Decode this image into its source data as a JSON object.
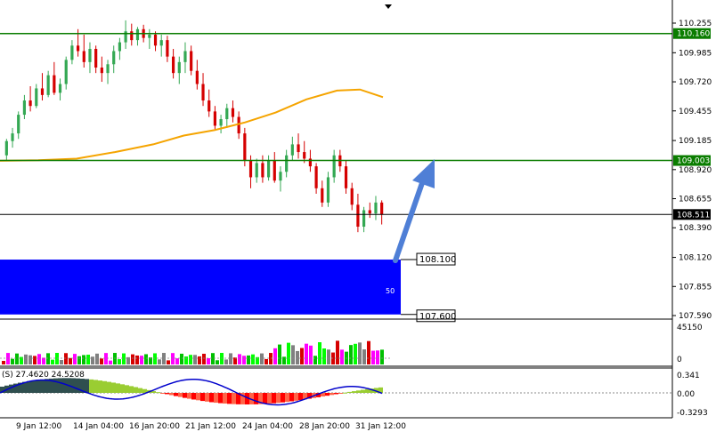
{
  "price_axis": {
    "ticks": [
      "110.255",
      "109.985",
      "109.720",
      "109.455",
      "109.185",
      "108.920",
      "108.655",
      "108.390",
      "108.120",
      "107.855",
      "107.590"
    ],
    "tick_values": [
      110.255,
      109.985,
      109.72,
      109.455,
      109.185,
      108.92,
      108.655,
      108.39,
      108.12,
      107.855,
      107.59
    ]
  },
  "levels": {
    "resistance_upper": {
      "value": 110.16,
      "label": "110.160"
    },
    "resistance_lower": {
      "value": 109.003,
      "label": "109.003"
    },
    "current_price": {
      "value": 108.511,
      "label": "108.511"
    }
  },
  "zone": {
    "top_label": "108.100",
    "top_value": 108.1,
    "bottom_label": "107.600",
    "bottom_value": 107.6,
    "inner_text": "50"
  },
  "volume_panel": {
    "max_label": "45150",
    "min_label": "0"
  },
  "oscillator_panel": {
    "title": "(S) 27.4620 24.5208",
    "tick_labels": [
      "0.341",
      "0.00",
      "-0.3293"
    ]
  },
  "time_axis": {
    "labels": [
      "9 Jan 12:00",
      "14 Jan 04:00",
      "16 Jan 20:00",
      "21 Jan 12:00",
      "24 Jan 04:00",
      "28 Jan 20:00",
      "31 Jan 12:00"
    ]
  },
  "colors": {
    "bull": "#34a853",
    "bear": "#d50000",
    "ma_line": "#f5a400",
    "level_line": "#0a7d00",
    "zone_fill": "#0000ff",
    "arrow": "#4f7fd6",
    "osc_line": "#0000cc"
  },
  "chart_data": {
    "type": "candlestick",
    "candles": [
      [
        109.05,
        109.2,
        109.0,
        109.18
      ],
      [
        109.18,
        109.3,
        109.12,
        109.25
      ],
      [
        109.25,
        109.45,
        109.2,
        109.42
      ],
      [
        109.42,
        109.6,
        109.38,
        109.55
      ],
      [
        109.55,
        109.68,
        109.45,
        109.5
      ],
      [
        109.5,
        109.7,
        109.48,
        109.66
      ],
      [
        109.66,
        109.8,
        109.55,
        109.6
      ],
      [
        109.6,
        109.82,
        109.58,
        109.78
      ],
      [
        109.78,
        109.9,
        109.6,
        109.62
      ],
      [
        109.62,
        109.75,
        109.55,
        109.7
      ],
      [
        109.7,
        109.95,
        109.65,
        109.92
      ],
      [
        109.92,
        110.1,
        109.88,
        110.05
      ],
      [
        110.05,
        110.2,
        109.95,
        110.0
      ],
      [
        110.0,
        110.15,
        109.85,
        109.9
      ],
      [
        109.9,
        110.08,
        109.8,
        110.02
      ],
      [
        110.02,
        110.05,
        109.8,
        109.85
      ],
      [
        109.85,
        109.95,
        109.72,
        109.8
      ],
      [
        109.8,
        109.92,
        109.7,
        109.88
      ],
      [
        109.88,
        110.05,
        109.8,
        110.0
      ],
      [
        110.0,
        110.12,
        109.92,
        110.08
      ],
      [
        110.08,
        110.28,
        110.02,
        110.18
      ],
      [
        110.18,
        110.25,
        110.05,
        110.1
      ],
      [
        110.1,
        110.22,
        110.05,
        110.2
      ],
      [
        110.2,
        110.24,
        110.08,
        110.12
      ],
      [
        110.12,
        110.2,
        110.02,
        110.15
      ],
      [
        110.15,
        110.18,
        110.0,
        110.05
      ],
      [
        110.05,
        110.15,
        109.95,
        110.1
      ],
      [
        110.1,
        110.14,
        109.9,
        109.95
      ],
      [
        109.95,
        110.02,
        109.75,
        109.8
      ],
      [
        109.8,
        109.95,
        109.7,
        109.9
      ],
      [
        109.9,
        110.08,
        109.8,
        110.0
      ],
      [
        110.0,
        110.05,
        109.78,
        109.82
      ],
      [
        109.82,
        109.92,
        109.65,
        109.7
      ],
      [
        109.7,
        109.8,
        109.5,
        109.55
      ],
      [
        109.55,
        109.65,
        109.4,
        109.45
      ],
      [
        109.45,
        109.5,
        109.28,
        109.32
      ],
      [
        109.32,
        109.42,
        109.25,
        109.38
      ],
      [
        109.38,
        109.52,
        109.3,
        109.48
      ],
      [
        109.48,
        109.55,
        109.35,
        109.4
      ],
      [
        109.4,
        109.45,
        109.2,
        109.25
      ],
      [
        109.25,
        109.3,
        108.95,
        109.0
      ],
      [
        109.0,
        109.05,
        108.75,
        108.85
      ],
      [
        108.85,
        109.02,
        108.8,
        108.98
      ],
      [
        108.98,
        109.05,
        108.8,
        108.85
      ],
      [
        108.85,
        109.05,
        108.82,
        109.0
      ],
      [
        109.0,
        109.08,
        108.8,
        108.82
      ],
      [
        108.82,
        108.95,
        108.72,
        108.9
      ],
      [
        108.9,
        109.1,
        108.85,
        109.05
      ],
      [
        109.05,
        109.22,
        109.0,
        109.15
      ],
      [
        109.15,
        109.25,
        109.02,
        109.08
      ],
      [
        109.08,
        109.18,
        108.98,
        109.02
      ],
      [
        109.02,
        109.1,
        108.9,
        108.95
      ],
      [
        108.95,
        108.98,
        108.7,
        108.75
      ],
      [
        108.75,
        108.82,
        108.58,
        108.62
      ],
      [
        108.62,
        108.9,
        108.58,
        108.85
      ],
      [
        108.85,
        109.1,
        108.8,
        109.05
      ],
      [
        109.05,
        109.1,
        108.9,
        108.95
      ],
      [
        108.95,
        109.0,
        108.7,
        108.75
      ],
      [
        108.75,
        108.8,
        108.55,
        108.6
      ],
      [
        108.6,
        108.7,
        108.35,
        108.4
      ],
      [
        108.4,
        108.58,
        108.35,
        108.55
      ],
      [
        108.55,
        108.62,
        108.48,
        108.52
      ],
      [
        108.52,
        108.68,
        108.46,
        108.62
      ],
      [
        108.62,
        108.64,
        108.42,
        108.51
      ]
    ],
    "moving_average": [
      [
        0,
        109.0
      ],
      [
        0.1,
        109.005
      ],
      [
        0.2,
        109.02
      ],
      [
        0.3,
        109.08
      ],
      [
        0.4,
        109.15
      ],
      [
        0.48,
        109.23
      ],
      [
        0.56,
        109.28
      ],
      [
        0.64,
        109.35
      ],
      [
        0.72,
        109.44
      ],
      [
        0.8,
        109.56
      ],
      [
        0.88,
        109.64
      ],
      [
        0.94,
        109.65
      ],
      [
        1.0,
        109.58
      ]
    ]
  }
}
